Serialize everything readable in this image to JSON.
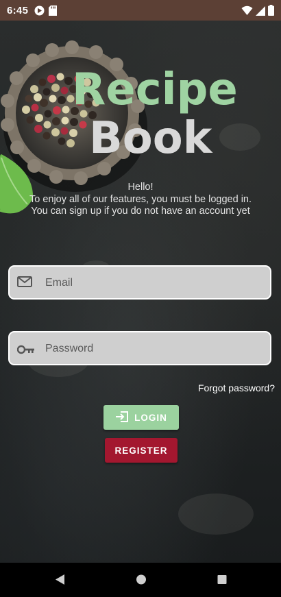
{
  "status_bar": {
    "time": "6:45"
  },
  "logo": {
    "line1": "Recipe",
    "line2": "Book",
    "line1_color": "#9fd3a2",
    "line2_color": "#d9d9d9"
  },
  "intro": {
    "greeting": "Hello!",
    "message": "To enjoy all of our features, you must be logged in. You can sign up if you do not have an account yet"
  },
  "form": {
    "email_placeholder": "Email",
    "email_icon": "envelope-icon",
    "password_placeholder": "Password",
    "password_icon": "key-icon",
    "forgot_label": "Forgot password?"
  },
  "buttons": {
    "login_label": "LOGIN",
    "login_icon": "login-arrow-icon",
    "login_color": "#9bd29f",
    "register_label": "REGISTER",
    "register_color": "#a3172f"
  },
  "nav_bar": {
    "back_icon": "back-triangle-icon",
    "home_icon": "home-circle-icon",
    "recents_icon": "recents-square-icon"
  }
}
